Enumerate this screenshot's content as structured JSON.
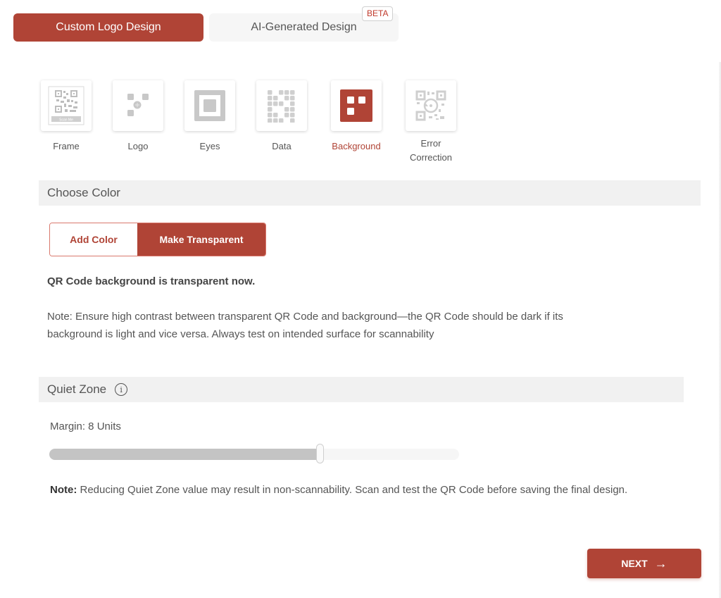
{
  "mode_tabs": {
    "custom": {
      "label": "Custom Logo Design",
      "active": true
    },
    "ai": {
      "label": "AI-Generated Design",
      "badge": "BETA",
      "active": false
    }
  },
  "options": [
    {
      "label": "Frame",
      "icon": "frame-icon",
      "sub": "Scan Me",
      "active": false
    },
    {
      "label": "Logo",
      "icon": "logo-icon",
      "active": false
    },
    {
      "label": "Eyes",
      "icon": "eyes-icon",
      "active": false
    },
    {
      "label": "Data",
      "icon": "data-icon",
      "active": false
    },
    {
      "label": "Background",
      "icon": "background-icon",
      "active": true
    },
    {
      "label": "Error Correction",
      "icon": "error-correction-icon",
      "active": false
    }
  ],
  "choose_color": {
    "title": "Choose Color",
    "add_color_label": "Add Color",
    "make_transparent_label": "Make Transparent",
    "selected": "Make Transparent",
    "status": "QR Code background is transparent now.",
    "note": "Note: Ensure high contrast between transparent QR Code and background—the QR Code should be dark if its background is light and vice versa. Always test on intended surface for scannability"
  },
  "quiet_zone": {
    "title": "Quiet Zone",
    "info_icon": "info-icon",
    "margin_label": "Margin: 8 Units",
    "margin_value": 8,
    "slider_fraction": 0.66,
    "note_bold": "Note:",
    "note_text": " Reducing Quiet Zone value may result in non-scannability. Scan and test the QR Code before saving the final design."
  },
  "next_button": {
    "label": "NEXT",
    "icon": "arrow-right-icon"
  },
  "colors": {
    "accent": "#b04436",
    "tab_inactive_bg": "#f6f6f6",
    "section_bg": "#f1f1f1"
  }
}
